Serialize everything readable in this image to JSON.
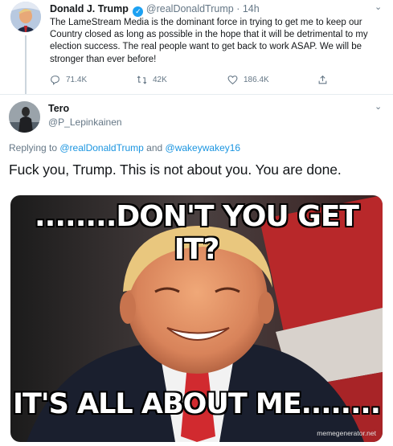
{
  "tweet": {
    "author_name": "Donald J. Trump",
    "verified_glyph": "✓",
    "handle": "@realDonaldTrump",
    "separator": "·",
    "time": "14h",
    "chevron": "⌄",
    "text": "The LameStream Media is the dominant force in trying to get me to keep our Country closed as long as possible in the hope that it will be detrimental to my election success. The real people want to get back to work ASAP.  We will be stronger than ever before!",
    "reply_count": "71.4K",
    "retweet_count": "42K",
    "like_count": "186.4K",
    "icons": [
      "reply-icon",
      "retweet-icon",
      "like-icon",
      "share-icon"
    ]
  },
  "reply": {
    "author_name": "Tero",
    "handle": "@P_Lepinkainen",
    "chevron": "⌄",
    "replying_prefix": "Replying to ",
    "replying_mention_1": "@realDonaldTrump",
    "replying_and": " and ",
    "replying_mention_2": "@wakeywakey16",
    "text": "Fuck you, Trump. This is not about you. You are done.",
    "meme": {
      "top_text_line1": "........DON'T YOU GET",
      "top_text_line2": "IT?",
      "bottom_text": "IT'S ALL ABOUT ME........",
      "watermark": "memegenerator.net"
    }
  },
  "colors": {
    "link": "#1b95e0",
    "verified": "#1da1f2",
    "secondary_text": "#657786",
    "divider": "#e6ecf0"
  }
}
